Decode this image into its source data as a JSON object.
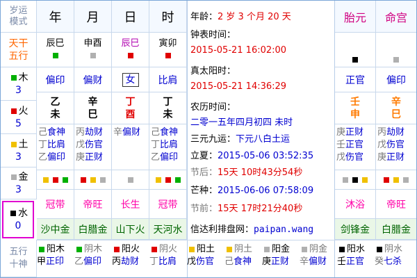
{
  "left": {
    "mode": [
      "岁运",
      "模式"
    ],
    "tiangan": [
      "天干",
      "五行"
    ],
    "elements": [
      {
        "name": "木",
        "count": "3",
        "color": "#00b000"
      },
      {
        "name": "火",
        "count": "5",
        "color": "#e00000"
      },
      {
        "name": "土",
        "count": "3",
        "color": "#f0c000"
      },
      {
        "name": "金",
        "count": "3",
        "color": "#b0b0b0"
      },
      {
        "name": "水",
        "count": "0",
        "color": "#000000"
      }
    ],
    "bottom": [
      "五行",
      "十神"
    ]
  },
  "pillars": {
    "headers": [
      "年",
      "月",
      "日",
      "时"
    ],
    "kongwang": [
      "辰巳",
      "申酉",
      "辰巳",
      "寅卯"
    ],
    "shishen": [
      "偏印",
      "偏财",
      "女",
      "比肩"
    ],
    "gan": [
      "乙",
      "辛",
      "丁",
      "丁"
    ],
    "zhi": [
      "未",
      "巳",
      "酉",
      "未"
    ],
    "canggan": [
      [
        [
          "己",
          "食神"
        ],
        [
          "丁",
          "比肩"
        ],
        [
          "乙",
          "偏印"
        ]
      ],
      [
        [
          "丙",
          "劫财"
        ],
        [
          "戊",
          "伤官"
        ],
        [
          "庚",
          "正财"
        ]
      ],
      [
        [
          "辛",
          "偏财"
        ]
      ],
      [
        [
          "己",
          "食神"
        ],
        [
          "丁",
          "比肩"
        ],
        [
          "乙",
          "偏印"
        ]
      ]
    ],
    "changsheng": [
      "冠带",
      "帝旺",
      "长生",
      "冠带"
    ],
    "nayin": [
      "沙中金",
      "白腊金",
      "山下火",
      "天河水"
    ]
  },
  "info": {
    "age_label": "年龄：",
    "age_value": "2 岁 3 个月 20 天",
    "clock_label": "钟表时间：",
    "clock_value": "2015-05-21 16:02:00",
    "solar_label": "真太阳时：",
    "solar_value": "2015-05-21 14:36:29",
    "lunar_label": "农历时间：",
    "lunar_value": "二零一五年四月初四 未时",
    "yuanyun_label": "三元九运：",
    "yuanyun_value": "下元八白土运",
    "lixia_label": "立夏：",
    "lixia_value": "2015-05-06 03:52:35",
    "after_label": "节后：",
    "after_value": "15天 10时43分54秒",
    "mangzhong_label": "芒种：",
    "mangzhong_value": "2015-06-06 07:58:09",
    "before_label": "节前：",
    "before_value": "15天 17时21分40秒",
    "site_label": "信达利排盘网：",
    "site_value": "paipan.wang"
  },
  "right": {
    "headers": [
      "胎元",
      "命宫"
    ],
    "shishen": [
      "正官",
      "偏印"
    ],
    "gan": [
      "壬",
      "辛"
    ],
    "zhi": [
      "申",
      "巳"
    ],
    "canggan": [
      [
        [
          "庚",
          "正财"
        ],
        [
          "壬",
          "正官"
        ],
        [
          "戊",
          "伤官"
        ]
      ],
      [
        [
          "丙",
          "劫财"
        ],
        [
          "戊",
          "伤官"
        ],
        [
          "庚",
          "正财"
        ]
      ]
    ],
    "changsheng": [
      "沐浴",
      "帝旺"
    ],
    "nayin": [
      "剑锋金",
      "白腊金"
    ]
  },
  "bottom": [
    {
      "label": "阳木",
      "gan": "甲",
      "shen": "正印"
    },
    {
      "label": "阴木",
      "gan": "乙",
      "shen": "偏印"
    },
    {
      "label": "阳火",
      "gan": "丙",
      "shen": "劫财"
    },
    {
      "label": "阴火",
      "gan": "丁",
      "shen": "比肩"
    },
    {
      "label": "阳土",
      "gan": "戊",
      "shen": "伤官"
    },
    {
      "label": "阴土",
      "gan": "己",
      "shen": "食神"
    },
    {
      "label": "阳金",
      "gan": "庚",
      "shen": "正财"
    },
    {
      "label": "阴金",
      "gan": "辛",
      "shen": "偏财"
    },
    {
      "label": "阳水",
      "gan": "壬",
      "shen": "正官"
    },
    {
      "label": "阴水",
      "gan": "癸",
      "shen": "七杀"
    }
  ]
}
